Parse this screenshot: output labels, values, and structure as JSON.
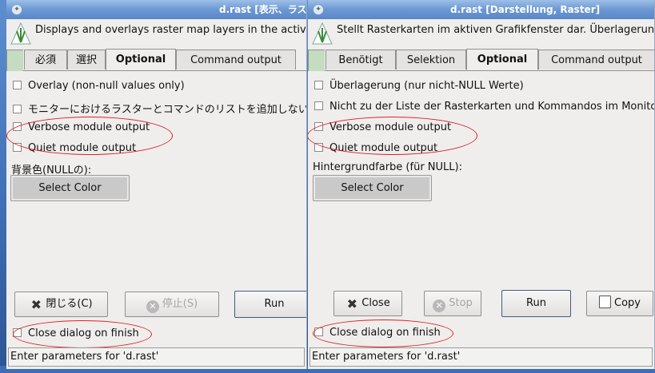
{
  "left_window": {
    "title": "d.rast [表示、ラス",
    "description": "Displays and overlays raster map layers in the active",
    "tabs": [
      "必須",
      "選択",
      "Optional",
      "Command output"
    ],
    "active_tab": "Optional",
    "options": [
      "Overlay (non-null values only)",
      "モニターにおけるラスターとコマンドのリストを追加しない",
      "Verbose module output",
      "Quiet module output"
    ],
    "bg_label": "背景色(NULLの):",
    "select_color": "Select Color",
    "buttons": {
      "close": "閉じる(C)",
      "stop": "停止(S)",
      "run": "Run"
    },
    "close_on_finish": "Close dialog on finish",
    "status": "Enter parameters for 'd.rast'"
  },
  "right_window": {
    "title": "d.rast [Darstellung, Raster]",
    "description": "Stellt Rasterkarten im aktiven Grafikfenster dar. Überlagerung",
    "tabs": [
      "Benötigt",
      "Selektion",
      "Optional",
      "Command output"
    ],
    "active_tab": "Optional",
    "options": [
      "Überlagerung (nur nicht-NULL Werte)",
      "Nicht zu der Liste der Rasterkarten und Kommandos im Monitor",
      "Verbose module output",
      "Quiet module output"
    ],
    "bg_label": "Hintergrundfarbe (für NULL):",
    "select_color": "Select Color",
    "buttons": {
      "close": "Close",
      "stop": "Stop",
      "run": "Run",
      "copy": "Copy"
    },
    "close_on_finish": "Close dialog on finish",
    "status": "Enter parameters for 'd.rast'"
  },
  "colors": {
    "annotation_ellipse": "#dd2222",
    "titlebar": "#6c98d2"
  }
}
